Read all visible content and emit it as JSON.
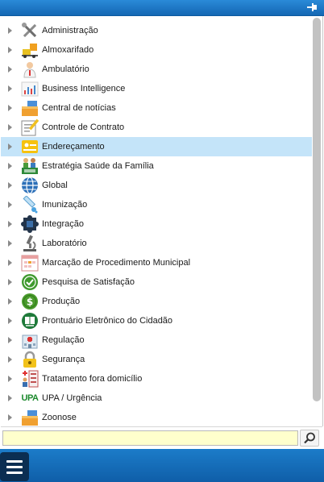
{
  "search": {
    "value": "",
    "placeholder": ""
  },
  "menu": {
    "items": [
      {
        "label": "Administração",
        "icon": "tools-icon"
      },
      {
        "label": "Almoxarifado",
        "icon": "forklift-icon"
      },
      {
        "label": "Ambulatório",
        "icon": "doctor-icon"
      },
      {
        "label": "Business Intelligence",
        "icon": "bar-chart-icon"
      },
      {
        "label": "Central de notícias",
        "icon": "boxes-icon"
      },
      {
        "label": "Controle de Contrato",
        "icon": "document-pen-icon"
      },
      {
        "label": "Endereçamento",
        "icon": "address-card-icon",
        "selected": true
      },
      {
        "label": "Estratégia Saúde da Família",
        "icon": "family-icon"
      },
      {
        "label": "Global",
        "icon": "globe-icon"
      },
      {
        "label": "Imunização",
        "icon": "syringe-icon"
      },
      {
        "label": "Integração",
        "icon": "puzzle-icon"
      },
      {
        "label": "Laboratório",
        "icon": "microscope-icon"
      },
      {
        "label": "Marcação de Procedimento Municipal",
        "icon": "calendar-icon"
      },
      {
        "label": "Pesquisa de Satisfação",
        "icon": "check-badge-icon"
      },
      {
        "label": "Produção",
        "icon": "dollar-icon"
      },
      {
        "label": "Prontuário Eletrônico do Cidadão",
        "icon": "record-book-icon"
      },
      {
        "label": "Regulação",
        "icon": "hospital-icon"
      },
      {
        "label": "Segurança",
        "icon": "padlock-icon"
      },
      {
        "label": "Tratamento fora domicílio",
        "icon": "medical-transport-icon"
      },
      {
        "label": "UPA / Urgência",
        "icon": "upa-icon",
        "icon_text": "UPA"
      },
      {
        "label": "Zoonose",
        "icon": "boxes-icon"
      }
    ]
  },
  "colors": {
    "header": "#1b74c4",
    "selected_row": "#c4e4f9",
    "search_background": "#ffffcc",
    "menu_button": "#0b2e52"
  }
}
